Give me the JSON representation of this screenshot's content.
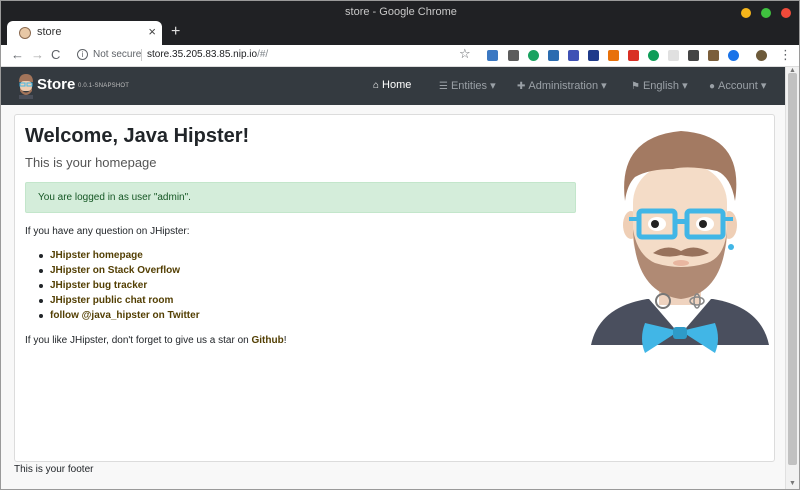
{
  "window": {
    "title": "store - Google Chrome"
  },
  "tab": {
    "title": "store",
    "close": "×",
    "new_tab": "+"
  },
  "toolbar": {
    "back": "←",
    "forward": "→",
    "reload": "C",
    "security": "Not secure",
    "url_host": "store.35.205.83.85.nip.io",
    "url_path": "/#/",
    "star": "☆",
    "menu": "⋮"
  },
  "navbar": {
    "brand": "Store",
    "version": "0.0.1-SNAPSHOT",
    "items": [
      {
        "label": "Home",
        "icon": "home-icon"
      },
      {
        "label": "Entities ▾",
        "icon": "list-icon"
      },
      {
        "label": "Administration ▾",
        "icon": "user-plus-icon"
      },
      {
        "label": "English ▾",
        "icon": "flag-icon"
      },
      {
        "label": "Account ▾",
        "icon": "user-icon"
      }
    ]
  },
  "main": {
    "title": "Welcome, Java Hipster!",
    "subtitle": "This is your homepage",
    "alert": "You are logged in as user \"admin\".",
    "question": "If you have any question on JHipster:",
    "links": [
      "JHipster homepage",
      "JHipster on Stack Overflow",
      "JHipster bug tracker",
      "JHipster public chat room",
      "follow @java_hipster on Twitter"
    ],
    "star_prefix": "If you like JHipster, don't forget to give us a star on ",
    "star_link": "Github",
    "star_suffix": "!"
  },
  "footer": {
    "text": "This is your footer"
  },
  "colors": {
    "navbar": "#343a40",
    "alert_bg": "#d4edda",
    "alert_text": "#155724",
    "link": "#533f03"
  }
}
